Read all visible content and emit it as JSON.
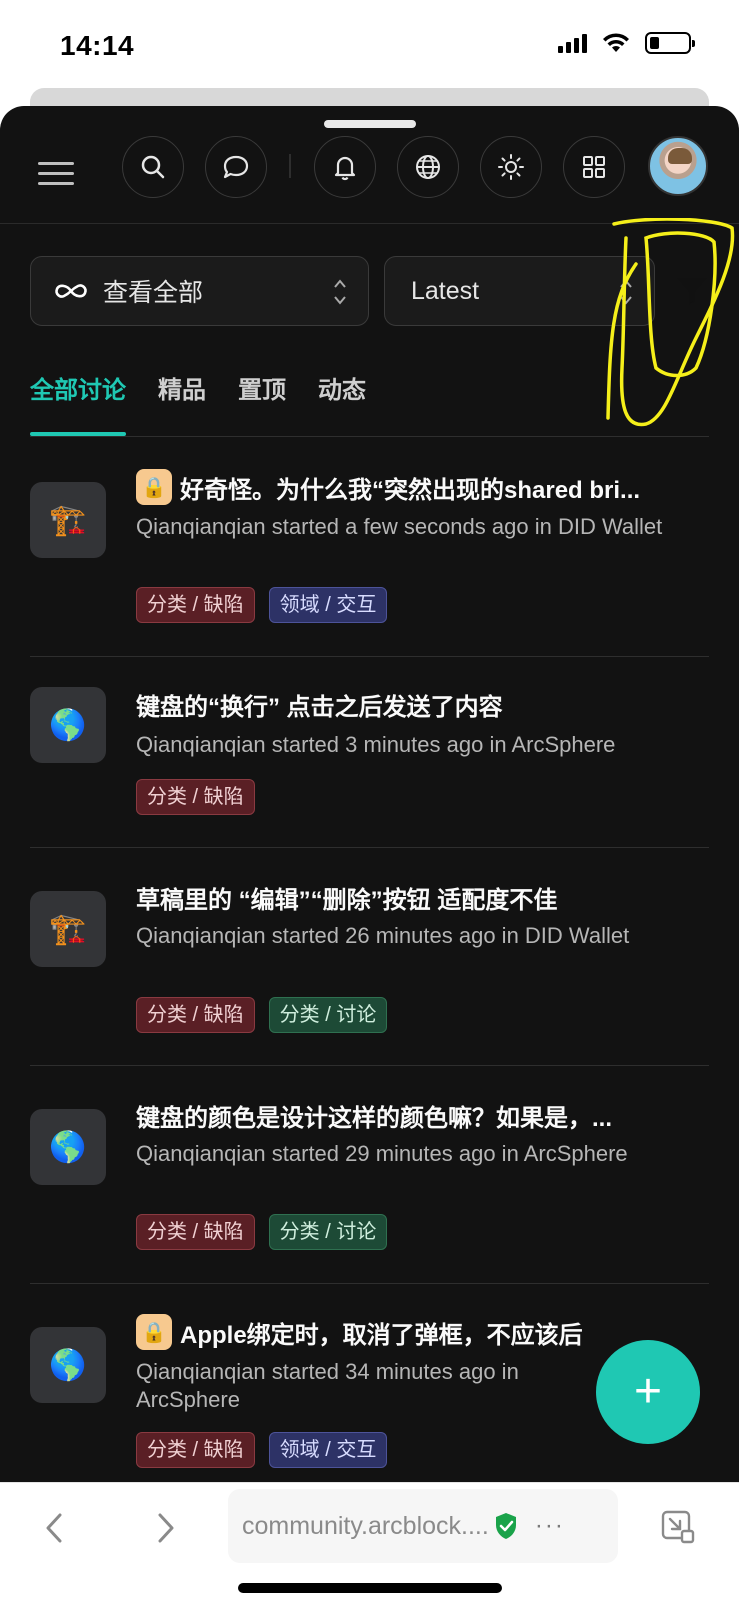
{
  "status_bar": {
    "time": "14:14"
  },
  "toolbar": {
    "icons": [
      "menu-icon",
      "search-icon",
      "chat-icon",
      "bell-icon",
      "globe-icon",
      "sun-icon",
      "grid-icon",
      "avatar"
    ]
  },
  "filters": {
    "view": {
      "label": "查看全部"
    },
    "sort": {
      "label": "Latest"
    }
  },
  "tabs": [
    {
      "label": "全部讨论",
      "active": true
    },
    {
      "label": "精品",
      "active": false
    },
    {
      "label": "置顶",
      "active": false
    },
    {
      "label": "动态",
      "active": false
    }
  ],
  "discussions": [
    {
      "icon": "🏗️",
      "locked": true,
      "title": "好奇怪。为什么我“突然出现的shared bri...",
      "meta": "Qianqianqian started a few seconds ago in DID Wallet",
      "tags": [
        {
          "label": "分类 / 缺陷",
          "color": "red"
        },
        {
          "label": "领域 / 交互",
          "color": "blue"
        }
      ]
    },
    {
      "icon": "🌎",
      "locked": false,
      "title": "键盘的“换行” 点击之后发送了内容",
      "meta": "Qianqianqian started 3 minutes ago in ArcSphere",
      "tags": [
        {
          "label": "分类 / 缺陷",
          "color": "red"
        }
      ]
    },
    {
      "icon": "🏗️",
      "locked": false,
      "title": "草稿里的 “编辑”“删除”按钮 适配度不佳",
      "meta": "Qianqianqian started 26 minutes ago in DID Wallet",
      "tags": [
        {
          "label": "分类 / 缺陷",
          "color": "red"
        },
        {
          "label": "分类 / 讨论",
          "color": "green"
        }
      ]
    },
    {
      "icon": "🌎",
      "locked": false,
      "title": "键盘的颜色是设计这样的颜色嘛？如果是，...",
      "meta": "Qianqianqian started 29 minutes ago in ArcSphere",
      "tags": [
        {
          "label": "分类 / 缺陷",
          "color": "red"
        },
        {
          "label": "分类 / 讨论",
          "color": "green"
        }
      ]
    },
    {
      "icon": "🌎",
      "locked": true,
      "title": "Apple绑定时，取消了弹框，不应该后",
      "meta": "Qianqianqian started 34 minutes ago in ArcSphere",
      "tags": [
        {
          "label": "分类 / 缺陷",
          "color": "red"
        },
        {
          "label": "领域 / 交互",
          "color": "blue"
        }
      ]
    }
  ],
  "fab": {
    "label": "+"
  },
  "browser": {
    "url": "community.arcblock....",
    "more": "···"
  },
  "colors": {
    "accent": "#1fc8b3",
    "background": "#121212",
    "annotation": "#f5ef1a"
  }
}
